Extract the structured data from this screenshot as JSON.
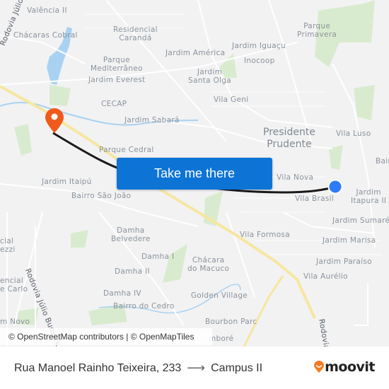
{
  "map": {
    "labels": {
      "valencia_ii": "Valência II",
      "chacaras_cobral": "Chácaras Cobral",
      "residencial_caranda": "Residencial\nCarandá",
      "parque_mediterraneo": "Parque\nMediterrâneo",
      "jardim_everest": "Jardim Everest",
      "cecap": "CECAP",
      "jardim_america": "Jardim América",
      "jardim_iguacu": "Jardim Iguaçu",
      "inocoop": "Inocoop",
      "jardim_santa_olga": "Jardim\nSanta Olga",
      "vila_geni": "Vila Geni",
      "parque_primavera": "Parque\nPrimavera",
      "jardim_sabara": "Jardim Sabará",
      "presidente_prudente": "Presidente\nPrudente",
      "vila_luso": "Vila Luso",
      "bair": "Bair",
      "parque_cedral": "Parque Cedral",
      "jardim_itaipu": "Jardim Itaipú",
      "bairro_sao_joao": "Bairro São João",
      "vila_nova": "Vila Nova",
      "vila_brasil": "Vila Brasil",
      "jardim_itapura_ii": "Jardim\nItapura II",
      "jardim_sumare": "Jardim Sumaré",
      "vila_formosa": "Vila Formosa",
      "jardim_marisa": "Jardim Marisa",
      "jardim_paraiso": "Jardim Paraíso",
      "vila_aurelio": "Vila Aurélio",
      "damha_belvedere": "Damha\nBelvedere",
      "damha_i": "Damha I",
      "damha_ii": "Damha II",
      "damha_iv": "Damha IV",
      "bairro_do_cedro": "Bairro do Cedro",
      "chacara_do_macuco": "Chácara\ndo Macuco",
      "golden_village": "Golden Village",
      "bourbon_parc": "Bourbon Parc",
      "cial_ezzi": "cial\nezzi",
      "encial_carlo": "encial\ne Carlo",
      "m_novo": "m Novo",
      "mbore": "mboré",
      "rodovia_julio_budisck": "Rodovia Júlio Budisck",
      "rodovia_julio_top": "Rodovia Júlio B",
      "rodovia_right": "Rodovia"
    },
    "take_me_there": "Take me there",
    "attribution": "© OpenStreetMap contributors | © OpenMapTiles",
    "colors": {
      "button": "#0d74d6",
      "destination_pin": "#f05a1a",
      "origin_dot": "#2d7cf6",
      "route_line": "#1a1a1a",
      "water": "#a9d2f2",
      "park": "#d4e8c8",
      "highway": "#f7e6a0"
    }
  },
  "footer": {
    "origin": "Rua Manoel Rainho Teixeira, 233",
    "arrow": "⟶",
    "destination": "Campus II",
    "brand": "moovit"
  }
}
